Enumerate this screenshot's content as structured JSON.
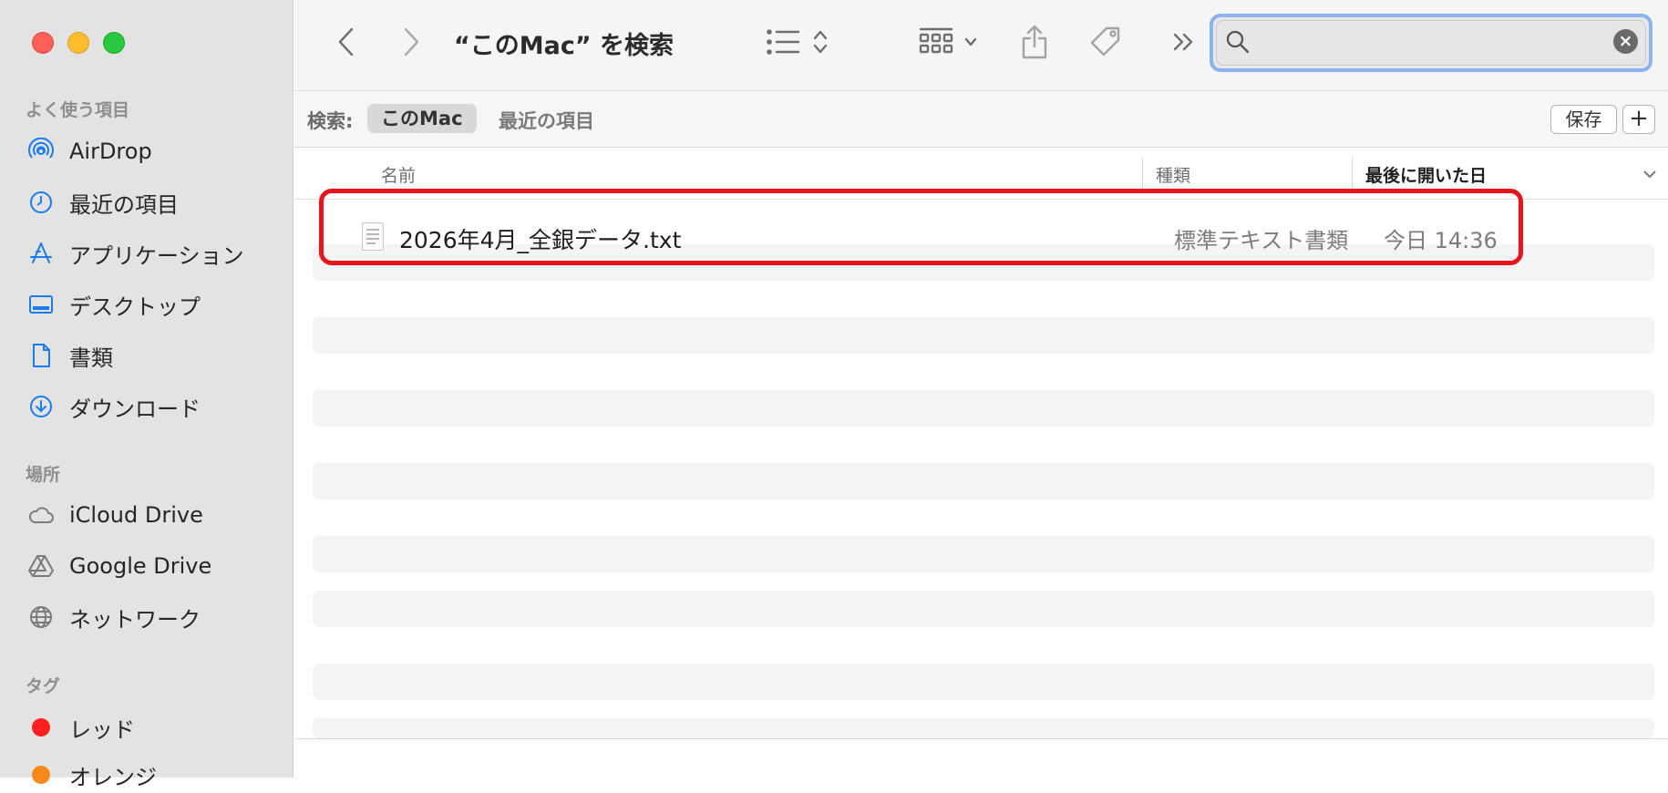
{
  "sidebar": {
    "favorites_header": "よく使う項目",
    "favorites": [
      {
        "label": "AirDrop",
        "icon": "airdrop-icon"
      },
      {
        "label": "最近の項目",
        "icon": "clock-icon"
      },
      {
        "label": "アプリケーション",
        "icon": "applications-icon"
      },
      {
        "label": "デスクトップ",
        "icon": "desktop-icon"
      },
      {
        "label": "書類",
        "icon": "document-icon"
      },
      {
        "label": "ダウンロード",
        "icon": "download-icon"
      }
    ],
    "locations_header": "場所",
    "locations": [
      {
        "label": "iCloud Drive",
        "icon": "cloud-icon"
      },
      {
        "label": "Google Drive",
        "icon": "google-drive-icon"
      },
      {
        "label": "ネットワーク",
        "icon": "globe-icon"
      }
    ],
    "tags_header": "タグ",
    "tags": [
      {
        "label": "レッド",
        "color": "#ff1f1f"
      },
      {
        "label": "オレンジ",
        "color": "#f5891d"
      }
    ]
  },
  "toolbar": {
    "title": "“このMac” を検索"
  },
  "search": {
    "value": "",
    "placeholder": ""
  },
  "scope": {
    "label": "検索:",
    "selected": "このMac",
    "other": "最近の項目",
    "save_label": "保存",
    "add_label": "+"
  },
  "columns": {
    "name": "名前",
    "kind": "種類",
    "date_opened": "最後に開いた日"
  },
  "results": [
    {
      "name": "2026年4月_全銀データ.txt",
      "kind": "標準テキスト書類",
      "date": "今日 14:36"
    }
  ],
  "colors": {
    "highlight": "#e8141c",
    "accent": "#007aff",
    "search_focus": "#8cb2ef"
  }
}
